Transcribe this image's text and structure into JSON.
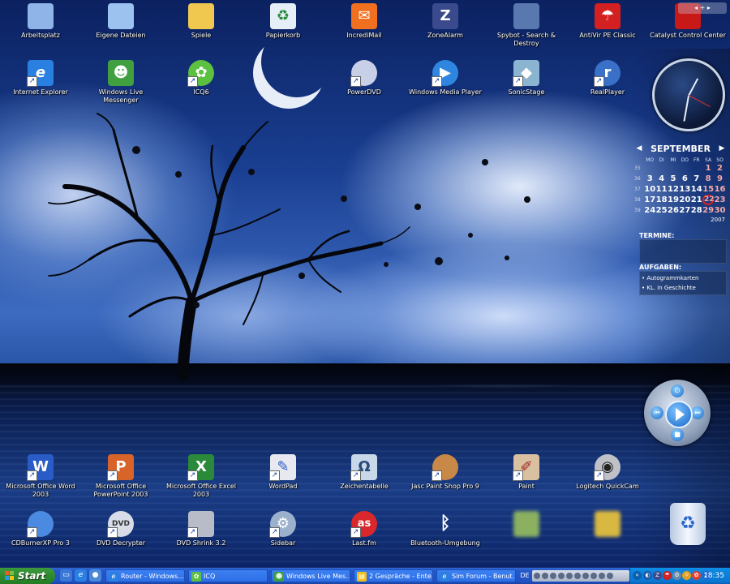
{
  "desktop_icons_top": [
    {
      "label": "Arbeitsplatz",
      "icon": "computer-icon",
      "color": "#8fb4e8"
    },
    {
      "label": "Eigene Dateien",
      "icon": "documents-icon",
      "color": "#9cc3f0"
    },
    {
      "label": "Spiele",
      "icon": "folder-icon",
      "color": "#f0c850"
    },
    {
      "label": "Papierkorb",
      "icon": "recycle-bin-icon",
      "color": "#e6eef8"
    },
    {
      "label": "IncrediMail",
      "icon": "mail-icon",
      "color": "#f07020"
    },
    {
      "label": "ZoneAlarm",
      "icon": "zonealarm-icon",
      "color": "#3a4a8c"
    },
    {
      "label": "Spybot - Search & Destroy",
      "icon": "spybot-icon",
      "color": "#5a78b0"
    },
    {
      "label": "AntiVir PE Classic",
      "icon": "antivir-icon",
      "color": "#d42020"
    },
    {
      "label": "Catalyst Control Center",
      "icon": "ati-icon",
      "color": "#c81818"
    }
  ],
  "desktop_icons_row2": [
    {
      "label": "Internet Explorer",
      "icon": "ie-icon",
      "color": "#2a80e0"
    },
    {
      "label": "Windows Live Messenger",
      "icon": "messenger-icon",
      "color": "#40a040"
    },
    {
      "label": "ICQ6",
      "icon": "icq-flower-icon",
      "color": "#5cc040"
    },
    {
      "label": "PowerDVD",
      "icon": "dvd-disc-icon",
      "color": "#c8d0e8"
    },
    {
      "label": "Windows Media Player",
      "icon": "media-player-icon",
      "color": "#2f86e0"
    },
    {
      "label": "SonicStage",
      "icon": "sonicstage-icon",
      "color": "#8ab4d0"
    },
    {
      "label": "RealPlayer",
      "icon": "realplayer-icon",
      "color": "#3a70c8"
    }
  ],
  "desktop_icons_row3": [
    {
      "label": "Microsoft Office Word 2003",
      "icon": "word-icon",
      "color": "#2a5cc8",
      "sym": "W"
    },
    {
      "label": "Microsoft Office PowerPoint 2003",
      "icon": "powerpoint-icon",
      "color": "#d8642a",
      "sym": "P"
    },
    {
      "label": "Microsoft Office Excel 2003",
      "icon": "excel-icon",
      "color": "#2a8a3a",
      "sym": "X"
    },
    {
      "label": "WordPad",
      "icon": "wordpad-icon",
      "color": "#e8e8f0"
    },
    {
      "label": "Zeichentabelle",
      "icon": "charmap-icon",
      "color": "#c8d8e8"
    },
    {
      "label": "Jasc Paint Shop Pro 9",
      "icon": "palette-icon",
      "color": "#c88848"
    },
    {
      "label": "Paint",
      "icon": "paint-brush-icon",
      "color": "#d8c0a0"
    },
    {
      "label": "Logitech QuickCam",
      "icon": "webcam-icon",
      "color": "#c0c0c8"
    }
  ],
  "desktop_icons_row4": [
    {
      "label": "CDBurnerXP Pro 3",
      "icon": "cd-burner-icon",
      "color": "#4a8ae0"
    },
    {
      "label": "DVD Decrypter",
      "icon": "dvd-icon",
      "color": "#d8dce8"
    },
    {
      "label": "DVD Shrink 3.2",
      "icon": "dvd-shrink-icon",
      "color": "#b8bcc8"
    },
    {
      "label": "Sidebar",
      "icon": "gear-icon",
      "color": "#9ab0cc"
    },
    {
      "label": "Last.fm",
      "icon": "lastfm-icon",
      "color": "#d8282c",
      "sym": "as"
    },
    {
      "label": "Bluetooth-Umgebung",
      "icon": "bluetooth-icon",
      "color": "#2a6ad0",
      "sym": "ᛒ"
    },
    {
      "label": "",
      "icon": "blurred-app-icon",
      "color": "#8ab060"
    },
    {
      "label": "",
      "icon": "blurred-folder-icon",
      "color": "#d8b840"
    },
    {
      "label": "",
      "icon": "recycle-bin-full-icon",
      "color": "#dce6f4"
    }
  ],
  "calendar": {
    "month": "SEPTEMBER",
    "year": "2007",
    "dow": [
      "MO",
      "DI",
      "MI",
      "DO",
      "FR",
      "SA",
      "SO"
    ],
    "weeks": [
      {
        "wk": "35",
        "days": [
          "",
          "",
          "",
          "",
          "",
          "1",
          "2"
        ]
      },
      {
        "wk": "36",
        "days": [
          "3",
          "4",
          "5",
          "6",
          "7",
          "8",
          "9"
        ]
      },
      {
        "wk": "37",
        "days": [
          "10",
          "11",
          "12",
          "13",
          "14",
          "15",
          "16"
        ]
      },
      {
        "wk": "38",
        "days": [
          "17",
          "18",
          "19",
          "20",
          "21",
          "22",
          "23"
        ]
      },
      {
        "wk": "39",
        "days": [
          "24",
          "25",
          "26",
          "27",
          "28",
          "29",
          "30"
        ]
      }
    ],
    "today": "22"
  },
  "termine": {
    "title": "TERMINE:"
  },
  "aufgaben": {
    "title": "AUFGABEN:",
    "tasks": [
      "• Autogrammkarten",
      "• KL. in Geschichte"
    ]
  },
  "gadget_toolbar": {
    "text": "◂ + ▸"
  },
  "taskbar": {
    "start_label": "Start",
    "quick_launch": [
      {
        "icon": "show-desktop-icon",
        "color": "#3a78d8",
        "sym": "▭"
      },
      {
        "icon": "ie-quick-icon",
        "color": "#2a80e0",
        "sym": "e"
      },
      {
        "icon": "media-quick-icon",
        "color": "#4a88d8",
        "sym": "●"
      }
    ],
    "buttons": [
      {
        "label": "Router - Windows...",
        "icon": "ie-small-icon",
        "color": "#2a80e0",
        "sym": "e"
      },
      {
        "label": "ICQ",
        "icon": "icq-small-icon",
        "color": "#5cc040",
        "sym": "✿"
      },
      {
        "label": "Windows Live Mes...",
        "icon": "messenger-small-icon",
        "color": "#40a040",
        "sym": "☻"
      },
      {
        "label": "2 Gespräche - Ente",
        "icon": "chat-small-icon",
        "color": "#f0c020",
        "sym": "▤"
      },
      {
        "label": "Sim Forum - Benut...",
        "icon": "ie-small-icon",
        "color": "#2a80e0",
        "sym": "e"
      }
    ],
    "language": "DE",
    "tray_icons": [
      {
        "icon": "tray-arrow-icon",
        "color": "#0a60b0",
        "sym": "«"
      },
      {
        "icon": "tray-network-icon",
        "color": "#1a5aa8",
        "sym": "◐"
      },
      {
        "icon": "tray-zonealarm-icon",
        "color": "#3a4a8c",
        "sym": "Z"
      },
      {
        "icon": "tray-antivir-icon",
        "color": "#d02020",
        "sym": "☂"
      },
      {
        "icon": "tray-gear-icon",
        "color": "#6a8aa8",
        "sym": "⚙"
      },
      {
        "icon": "tray-sun-icon",
        "color": "#e0a020",
        "sym": "☼"
      },
      {
        "icon": "tray-icq-icon",
        "color": "#e04030",
        "sym": "✿"
      },
      {
        "icon": "tray-volume-icon",
        "color": "#1a6ad0",
        "sym": "♪"
      }
    ],
    "clock": "18:35"
  }
}
